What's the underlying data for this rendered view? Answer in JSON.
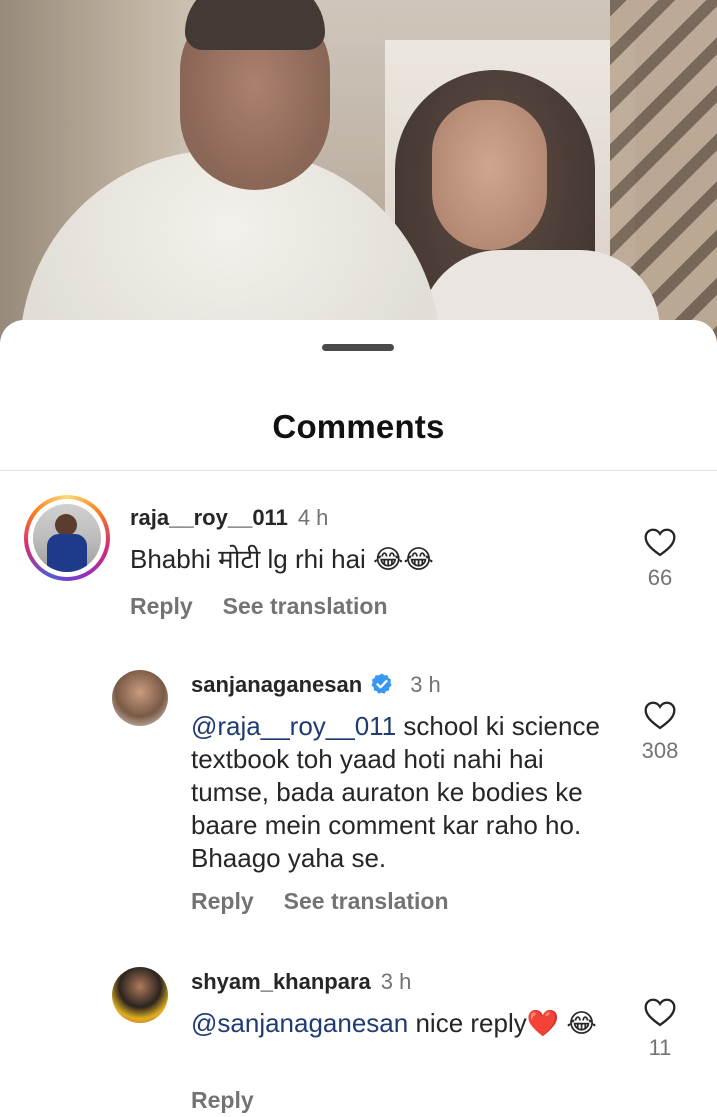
{
  "sheet": {
    "title": "Comments"
  },
  "comments": [
    {
      "username": "raja__roy__011",
      "time": "4 h",
      "text": "Bhabhi मोटी lg rhi hai 😂😂",
      "likes": "66",
      "reply_label": "Reply",
      "translate_label": "See translation"
    },
    {
      "username": "sanjanaganesan",
      "verified": true,
      "time": "3 h",
      "mention": "@raja__roy__011",
      "text": " school ki science textbook toh yaad hoti nahi hai tumse, bada auraton ke bodies ke baare mein comment kar raho ho. Bhaago yaha se.",
      "likes": "308",
      "reply_label": "Reply",
      "translate_label": "See translation"
    },
    {
      "username": "shyam_khanpara",
      "time": "3 h",
      "mention": "@sanjanaganesan",
      "text": " nice reply❤️ 😂",
      "likes": "11",
      "reply_label": "Reply"
    }
  ],
  "colors": {
    "verified": "#3897f0",
    "mention": "#1f3b73",
    "muted": "#737373"
  },
  "icons": [
    "heart-icon",
    "verified-badge-icon"
  ]
}
